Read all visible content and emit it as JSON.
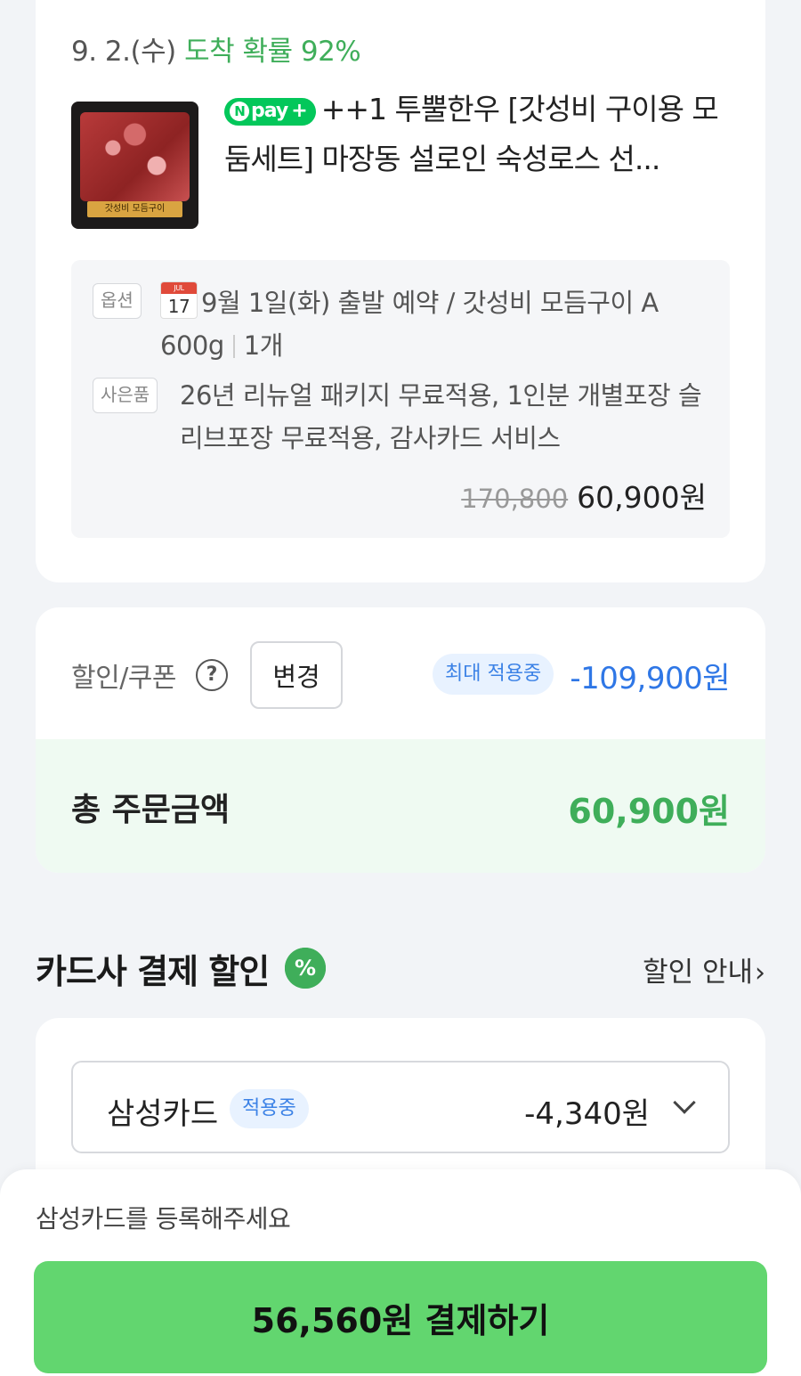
{
  "delivery": {
    "date": "9. 2.(수)",
    "probability": "도착 확률 92%"
  },
  "product": {
    "thumbnail_label": "갓성비 모듬구이",
    "npay_badge": "pay",
    "name": "++1 투뿔한우 [갓성비 구이용 모둠세트] 마장동 설로인 숙성로스 선..."
  },
  "option": {
    "option_tag": "옵션",
    "calendar_month": "JUL",
    "calendar_day": "17",
    "option_text_line1": "9월 1일(화) 출발 예약 / 갓성비 모듬구이 A",
    "option_weight": "600g",
    "option_qty": "1개",
    "gift_tag": "사은품",
    "gift_text": "26년 리뉴얼 패키지 무료적용, 1인분 개별포장 슬리브포장 무료적용, 감사카드 서비스",
    "original_price": "170,800",
    "price": "60,900원"
  },
  "discount": {
    "label": "할인/쿠폰",
    "help_icon": "?",
    "change_label": "변경",
    "max_badge": "최대 적용중",
    "amount": "-109,900원"
  },
  "total": {
    "label": "총 주문금액",
    "amount": "60,900원"
  },
  "card_discount": {
    "title": "카드사 결제 할인",
    "badge_icon": "%",
    "guide_link": "할인 안내",
    "selected_card": "삼성카드",
    "applied_badge": "적용중",
    "card_amount": "-4,340원"
  },
  "bottom": {
    "register_msg": "삼성카드를 등록해주세요",
    "pay_button": "56,560원 결제하기"
  },
  "colors": {
    "accent_green": "#3fae5a",
    "pay_button": "#62d66f",
    "discount_blue": "#2f77e6",
    "npay_green": "#03c75a"
  }
}
